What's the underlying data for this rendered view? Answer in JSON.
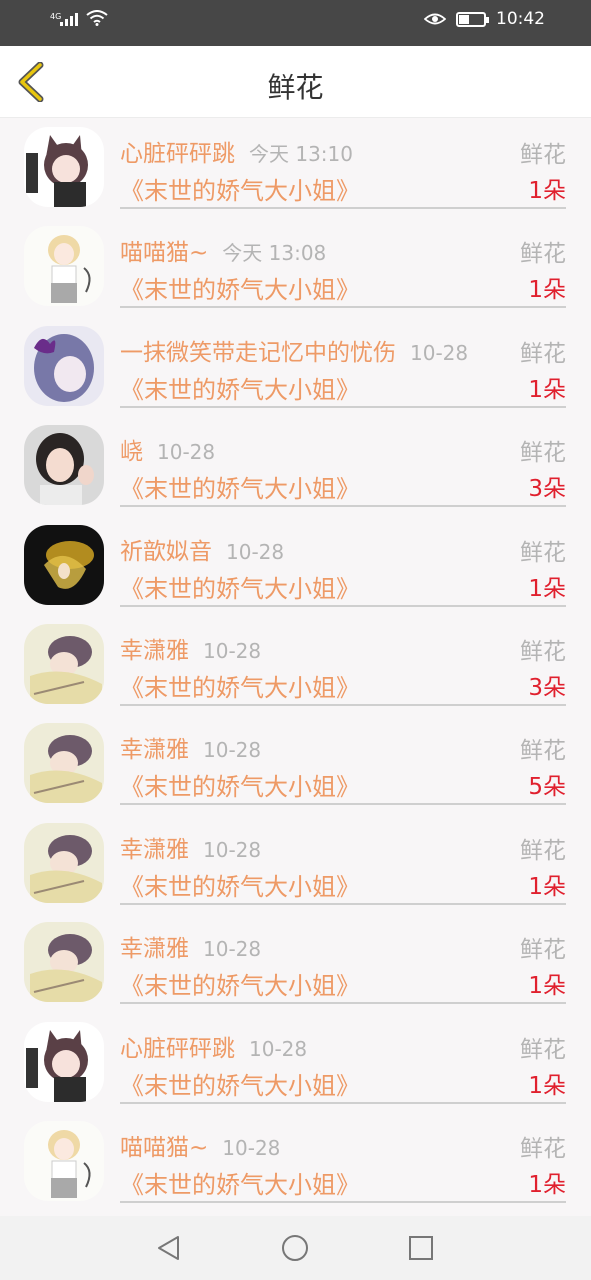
{
  "status_bar": {
    "network": "4G",
    "time": "10:42"
  },
  "header": {
    "title": "鲜花"
  },
  "items": [
    {
      "name": "心脏砰砰跳",
      "date": "今天 13:10",
      "book": "《末世的娇气大小姐》",
      "type": "鲜花",
      "count": "1朵",
      "avatar": "catgirl-dark"
    },
    {
      "name": "喵喵猫~",
      "date": "今天 13:08",
      "book": "《末世的娇气大小姐》",
      "type": "鲜花",
      "count": "1朵",
      "avatar": "catgirl-blonde"
    },
    {
      "name": "一抹微笑带走记忆中的忧伤",
      "date": "10-28",
      "book": "《末世的娇气大小姐》",
      "type": "鲜花",
      "count": "1朵",
      "avatar": "butterfly-girl"
    },
    {
      "name": "峣",
      "date": "10-28",
      "book": "《末世的娇气大小姐》",
      "type": "鲜花",
      "count": "3朵",
      "avatar": "photo-girl"
    },
    {
      "name": "祈歆姒音",
      "date": "10-28",
      "book": "《末世的娇气大小姐》",
      "type": "鲜花",
      "count": "1朵",
      "avatar": "dark-gold"
    },
    {
      "name": "幸潇雅",
      "date": "10-28",
      "book": "《末世的娇气大小姐》",
      "type": "鲜花",
      "count": "3朵",
      "avatar": "sleeping-boy"
    },
    {
      "name": "幸潇雅",
      "date": "10-28",
      "book": "《末世的娇气大小姐》",
      "type": "鲜花",
      "count": "5朵",
      "avatar": "sleeping-boy"
    },
    {
      "name": "幸潇雅",
      "date": "10-28",
      "book": "《末世的娇气大小姐》",
      "type": "鲜花",
      "count": "1朵",
      "avatar": "sleeping-boy"
    },
    {
      "name": "幸潇雅",
      "date": "10-28",
      "book": "《末世的娇气大小姐》",
      "type": "鲜花",
      "count": "1朵",
      "avatar": "sleeping-boy"
    },
    {
      "name": "心脏砰砰跳",
      "date": "10-28",
      "book": "《末世的娇气大小姐》",
      "type": "鲜花",
      "count": "1朵",
      "avatar": "catgirl-dark"
    },
    {
      "name": "喵喵猫~",
      "date": "10-28",
      "book": "《末世的娇气大小姐》",
      "type": "鲜花",
      "count": "1朵",
      "avatar": "catgirl-blonde"
    }
  ],
  "colors": {
    "name": "#ee9a66",
    "count": "#e0202e",
    "muted": "#b4b4b4",
    "back_icon": "#e8c60f"
  },
  "icons": {
    "back": "chevron-left-icon",
    "nav_back": "triangle-back-icon",
    "nav_home": "circle-home-icon",
    "nav_recent": "square-recent-icon"
  }
}
